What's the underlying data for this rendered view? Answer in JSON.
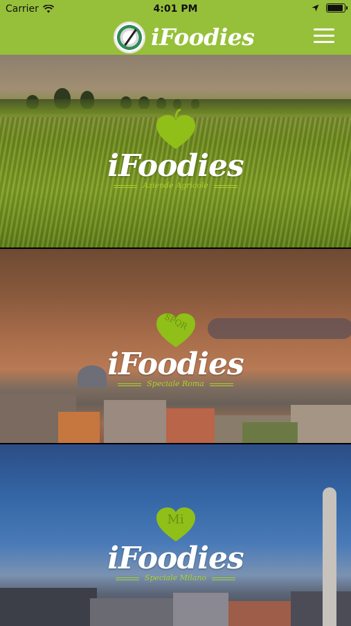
{
  "status_bar": {
    "carrier": "Carrier",
    "time": "4:01 PM"
  },
  "nav": {
    "title": "iFoodies"
  },
  "colors": {
    "accent": "#97c03a",
    "logo_green": "#a9d12a"
  },
  "cards": [
    {
      "title": "iFoodies",
      "subtitle": "Aziende Agricole",
      "heart_text": ""
    },
    {
      "title": "iFoodies",
      "subtitle": "Speciale Roma",
      "heart_text": "SPQR"
    },
    {
      "title": "iFoodies",
      "subtitle": "Speciale Milano",
      "heart_text": "Mi"
    }
  ]
}
